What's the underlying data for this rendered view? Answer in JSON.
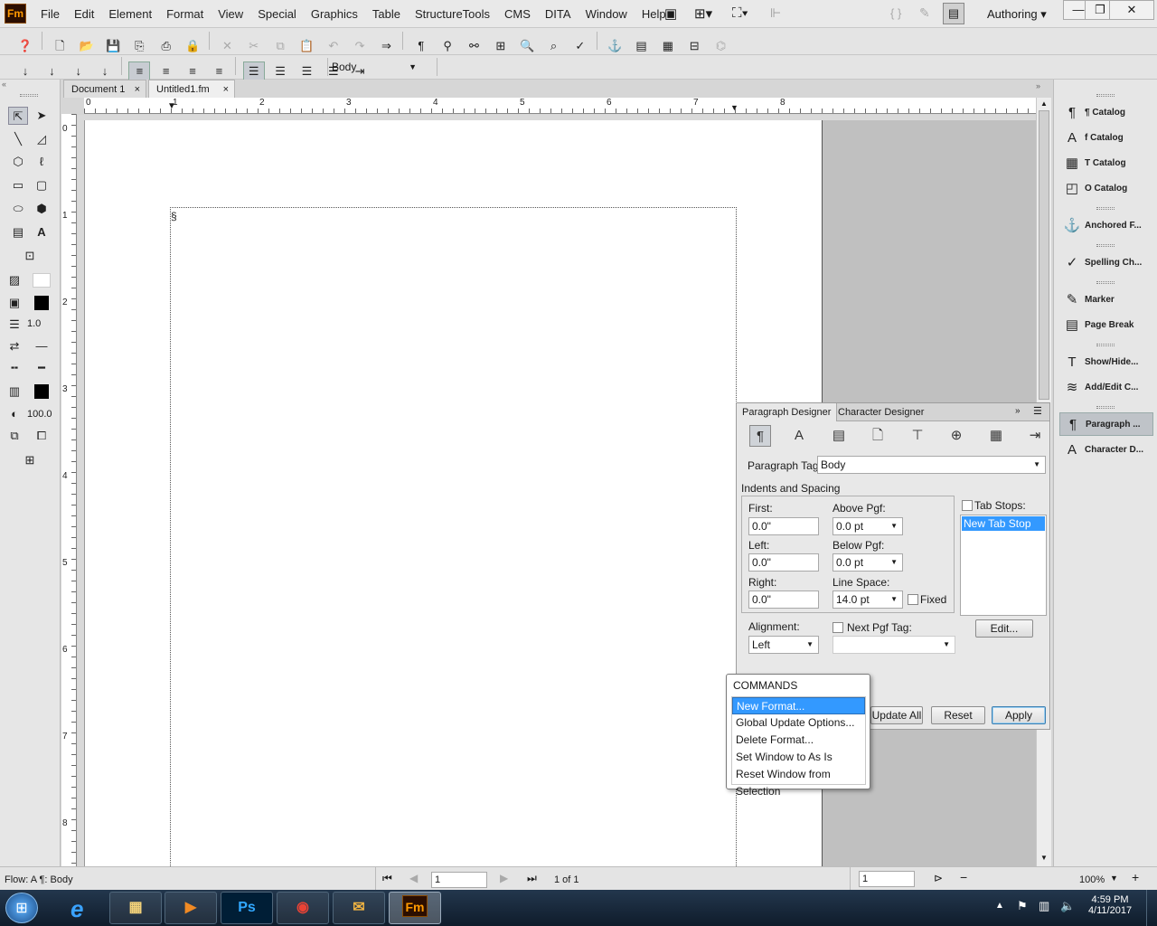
{
  "app": {
    "logo": "Fm",
    "mode": "Authoring"
  },
  "menu": [
    "File",
    "Edit",
    "Element",
    "Format",
    "View",
    "Special",
    "Graphics",
    "Table",
    "StructureTools",
    "CMS",
    "DITA",
    "Window",
    "Help"
  ],
  "format_bar": {
    "paragraph_tag": "Body"
  },
  "tabs": [
    {
      "label": "Document 1",
      "close": "×"
    },
    {
      "label": "Untitled1.fm",
      "close": "×"
    }
  ],
  "left_tools": {
    "line_width": "1.0",
    "tint": "100.0"
  },
  "hruler_labels": [
    "0",
    "1",
    "2",
    "3",
    "4",
    "5",
    "6",
    "7",
    "8"
  ],
  "vruler_labels": [
    "0",
    "1",
    "2",
    "3",
    "4",
    "5",
    "6",
    "7",
    "8"
  ],
  "right_panel": [
    {
      "label": "¶ Catalog",
      "icon": "paragraph-catalog-icon",
      "glyph": "¶"
    },
    {
      "label": "f Catalog",
      "icon": "character-catalog-icon",
      "glyph": "A"
    },
    {
      "label": "T Catalog",
      "icon": "table-catalog-icon",
      "glyph": "▦"
    },
    {
      "label": "O Catalog",
      "icon": "object-catalog-icon",
      "glyph": "◰"
    },
    {
      "label": "Anchored F...",
      "icon": "anchor-icon",
      "glyph": "⚓"
    },
    {
      "label": "Spelling Ch...",
      "icon": "spelling-icon",
      "glyph": "✓"
    },
    {
      "label": "Marker",
      "icon": "marker-icon",
      "glyph": "✎"
    },
    {
      "label": "Page Break",
      "icon": "page-break-icon",
      "glyph": "▤"
    },
    {
      "label": "Show/Hide...",
      "icon": "show-hide-icon",
      "glyph": "T"
    },
    {
      "label": "Add/Edit C...",
      "icon": "add-edit-icon",
      "glyph": "≋"
    },
    {
      "label": "Paragraph ...",
      "icon": "paragraph-designer-icon",
      "glyph": "¶"
    },
    {
      "label": "Character D...",
      "icon": "character-designer-icon",
      "glyph": "A"
    }
  ],
  "paragraph_designer": {
    "tab_active": "Paragraph Designer",
    "tab_other": "Character Designer",
    "tag_label": "Paragraph Tag:",
    "tag_value": "Body",
    "section": "Indents and Spacing",
    "first_label": "First:",
    "first": "0.0\"",
    "left_label": "Left:",
    "left": "0.0\"",
    "right_label": "Right:",
    "right": "0.0\"",
    "above_label": "Above Pgf:",
    "above": "0.0 pt",
    "below_label": "Below Pgf:",
    "below": "0.0 pt",
    "linespace_label": "Line Space:",
    "linespace": "14.0 pt",
    "fixed_label": "Fixed",
    "tabstops_label": "Tab Stops:",
    "tabstop_item": "New Tab Stop",
    "edit_button": "Edit...",
    "alignment_label": "Alignment:",
    "alignment": "Left",
    "nextpgf_label": "Next Pgf Tag:",
    "nextpgf": "",
    "update_all": "Update All",
    "reset": "Reset",
    "apply": "Apply"
  },
  "commands_popup": {
    "title": "COMMANDS",
    "items": [
      "New Format...",
      "Global Update Options...",
      "Delete Format...",
      "Set Window to As Is",
      "Reset Window from Selection"
    ]
  },
  "status": {
    "flow": "Flow: A  ¶: Body",
    "page_input": "1",
    "page_of": "1 of 1",
    "field2": "1",
    "zoom": "100%"
  },
  "taskbar": {
    "time": "4:59 PM",
    "date": "4/11/2017"
  },
  "colors": {
    "accent": "#3399ff",
    "fm_orange": "#ff9a00"
  }
}
